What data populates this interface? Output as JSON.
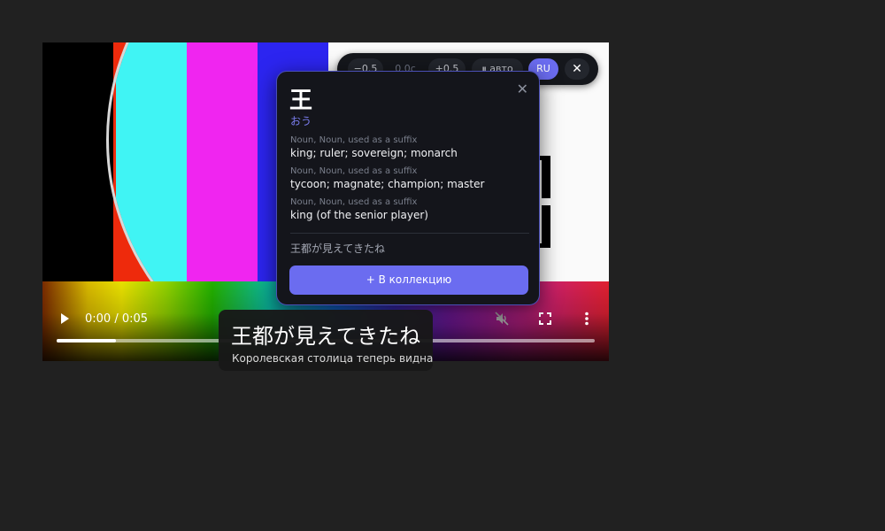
{
  "colors": {
    "accent": "#6b6cf0",
    "background": "#212121",
    "popup_bg": "#14151b",
    "test_bars": [
      "#000000",
      "#ee2a0c",
      "#40f4f4",
      "#f025f0",
      "#2c25f0",
      "#f0f000",
      "#20d020",
      "#40f4f4"
    ]
  },
  "player": {
    "play_icon": "play-icon",
    "time": "0:00 / 0:05",
    "progress": 0.11,
    "mute_icon": "volume-muted-icon",
    "fullscreen_icon": "fullscreen-icon",
    "more_icon": "more-vertical-icon"
  },
  "toolbar": {
    "minus": "−0.5",
    "offset": "0.0с",
    "plus": "+0.5",
    "auto": "⏸ авто",
    "lang": "RU",
    "close": "✕"
  },
  "popup": {
    "headword": "王",
    "reading": "おう",
    "senses": [
      {
        "pos": "Noun, Noun, used as a suffix",
        "gloss": "king; ruler; sovereign; monarch"
      },
      {
        "pos": "Noun, Noun, used as a suffix",
        "gloss": "tycoon; magnate; champion; master"
      },
      {
        "pos": "Noun, Noun, used as a suffix",
        "gloss": "king (of the senior player)"
      }
    ],
    "sentence": "王都が見えてきたね",
    "add_button": "+ В коллекцию",
    "close": "✕"
  },
  "subtitle": {
    "japanese": "王都が見えてきたね",
    "translation": "Королевская столица теперь видна"
  }
}
